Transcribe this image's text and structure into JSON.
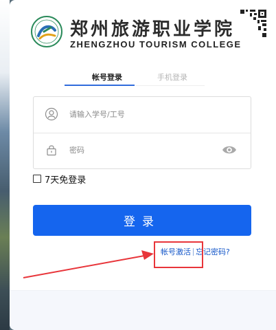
{
  "brand": {
    "name_cn": "郑州旅游职业学院",
    "name_en": "ZHENGZHOU TOURISM COLLEGE",
    "emblem_icon": "college-emblem-icon",
    "qr_icon": "qr-code-icon"
  },
  "tabs": [
    {
      "label": "帐号登录",
      "active": true
    },
    {
      "label": "手机登录",
      "active": false
    }
  ],
  "form": {
    "username_placeholder": "请输入学号/工号",
    "password_placeholder": "密码",
    "user_icon": "user-icon",
    "lock_icon": "lock-icon",
    "eye_icon": "eye-icon"
  },
  "remember_label": "7天免登录",
  "login_button": "登录",
  "links": {
    "activate": "帐号激活",
    "forgot": "忘记密码?"
  },
  "colors": {
    "primary": "#1565ee",
    "link": "#1557c9",
    "annotation": "#e8353a"
  }
}
